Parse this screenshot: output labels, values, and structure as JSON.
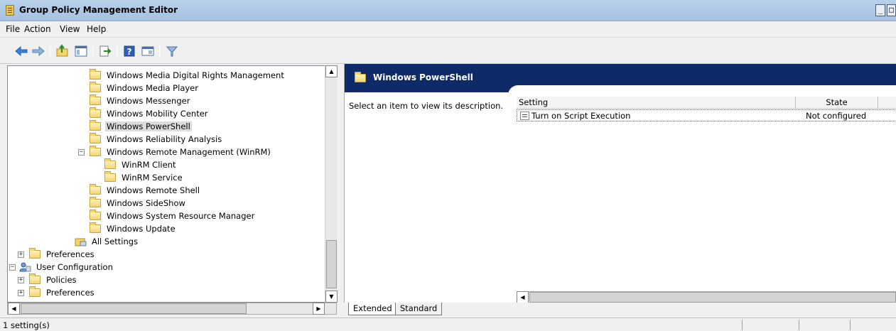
{
  "window": {
    "title": "Group Policy Management Editor"
  },
  "menu": {
    "file": "File",
    "action": "Action",
    "view": "View",
    "help": "Help"
  },
  "toolbar": {
    "icons": [
      "back-arrow-icon",
      "forward-arrow-icon",
      "up-folder-icon",
      "show-hide-tree-icon",
      "export-list-icon",
      "help-icon",
      "console-view-icon",
      "filter-icon"
    ]
  },
  "tree": {
    "items": [
      {
        "label": "Windows Media Digital Rights Management"
      },
      {
        "label": "Windows Media Player"
      },
      {
        "label": "Windows Messenger"
      },
      {
        "label": "Windows Mobility Center"
      },
      {
        "label": "Windows PowerShell",
        "selected": true
      },
      {
        "label": "Windows Reliability Analysis"
      },
      {
        "label": "Windows Remote Management (WinRM)",
        "expander": "⊟"
      },
      {
        "label": "WinRM Client"
      },
      {
        "label": "WinRM Service"
      },
      {
        "label": "Windows Remote Shell"
      },
      {
        "label": "Windows SideShow"
      },
      {
        "label": "Windows System Resource Manager"
      },
      {
        "label": "Windows Update"
      },
      {
        "label": "All Settings"
      },
      {
        "label": "Preferences",
        "expander": "⊞"
      },
      {
        "label": "User Configuration",
        "expander": "⊟"
      },
      {
        "label": "Policies",
        "expander": "⊞"
      },
      {
        "label": "Preferences",
        "expander": "⊞"
      }
    ]
  },
  "details": {
    "header_title": "Windows PowerShell",
    "description": "Select an item to view its description.",
    "columns": {
      "setting": "Setting",
      "state": "State"
    },
    "rows": [
      {
        "setting": "Turn on Script Execution",
        "state": "Not configured"
      }
    ]
  },
  "tabs": {
    "extended": "Extended",
    "standard": "Standard"
  },
  "status": {
    "text": "1 setting(s)"
  },
  "colors": {
    "header_bg": "#0e2a68",
    "titlebar": "#b9d1ea",
    "folder": "#f4d46b"
  }
}
